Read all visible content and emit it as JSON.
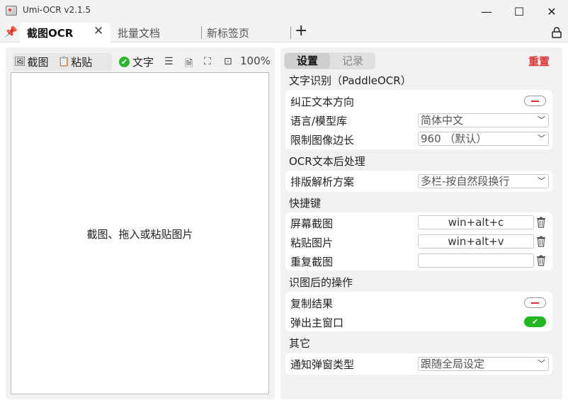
{
  "window": {
    "title": "Umi-OCR v2.1.5",
    "controls": {
      "minimize": "—",
      "maximize": "☐",
      "close": "✕"
    }
  },
  "tabs": {
    "active": "截图OCR",
    "others": [
      "批量文档",
      "新标签页"
    ],
    "close_glyph": "✕",
    "add_glyph": "+"
  },
  "left": {
    "toolbar": {
      "screenshot": "截图",
      "paste": "粘贴",
      "text": "文字",
      "zoom": "100%"
    },
    "canvas_hint": "截图、拖入或粘贴图片"
  },
  "right": {
    "tabs": {
      "settings": "设置",
      "records": "记录"
    },
    "reset": "重置",
    "sections": {
      "ocr": "文字识别（PaddleOCR）",
      "post": "OCR文本后处理",
      "hotkeys": "快捷键",
      "after": "识图后的操作",
      "other": "其它"
    },
    "rows": {
      "correct_direction": "纠正文本方向",
      "language": "语言/模型库",
      "language_value": "简体中文",
      "limit_side": "限制图像边长",
      "limit_side_value": "960 （默认）",
      "layout": "排版解析方案",
      "layout_value": "多栏-按自然段换行",
      "hk_screenshot": "屏幕截图",
      "hk_screenshot_value": "win+alt+c",
      "hk_paste": "粘贴图片",
      "hk_paste_value": "win+alt+v",
      "hk_repeat": "重复截图",
      "hk_repeat_value": "",
      "copy_result": "复制结果",
      "popup_main": "弹出主窗口",
      "notify_type": "通知弹窗类型",
      "notify_type_value": "跟随全局设定"
    },
    "toggles": {
      "correct_direction": false,
      "copy_result": false,
      "popup_main": true
    }
  },
  "colors": {
    "accent_green": "#20b720",
    "reset_red": "#e03030"
  }
}
